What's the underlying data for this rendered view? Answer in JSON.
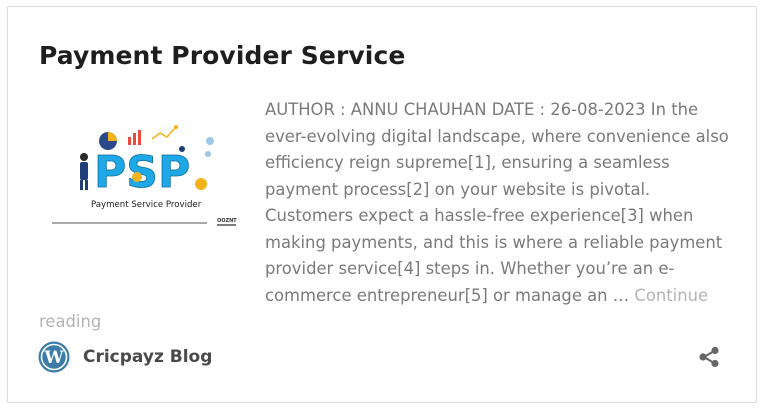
{
  "post": {
    "title": "Payment Provider Service",
    "excerpt": "AUTHOR : ANNU CHAUHAN DATE : 26-08-2023 In the ever-evolving digital landscape, where convenience also efficiency reign supreme[1], ensuring a seamless payment process[2] on your website is pivotal. Customers expect a hassle-free experience[3] when making payments, and this is where a reliable payment provider service[4] steps in. Whether you’re an e-commerce entrepreneur[5] or manage an …",
    "continue_label": "Continue reading",
    "thumbnail": {
      "main_text": "PSP",
      "caption": "Payment Service Provider",
      "logo_text": "OOZNT"
    }
  },
  "footer": {
    "blog_name": "Cricpayz Blog",
    "site_icon": "wordpress-icon",
    "share_icon": "share-icon"
  },
  "colors": {
    "title": "#1e1e1e",
    "excerpt": "#7a7a7a",
    "link": "#b4b4b4",
    "psp_blue": "#1fa8e6",
    "wp_blue": "#3b7ca8"
  }
}
